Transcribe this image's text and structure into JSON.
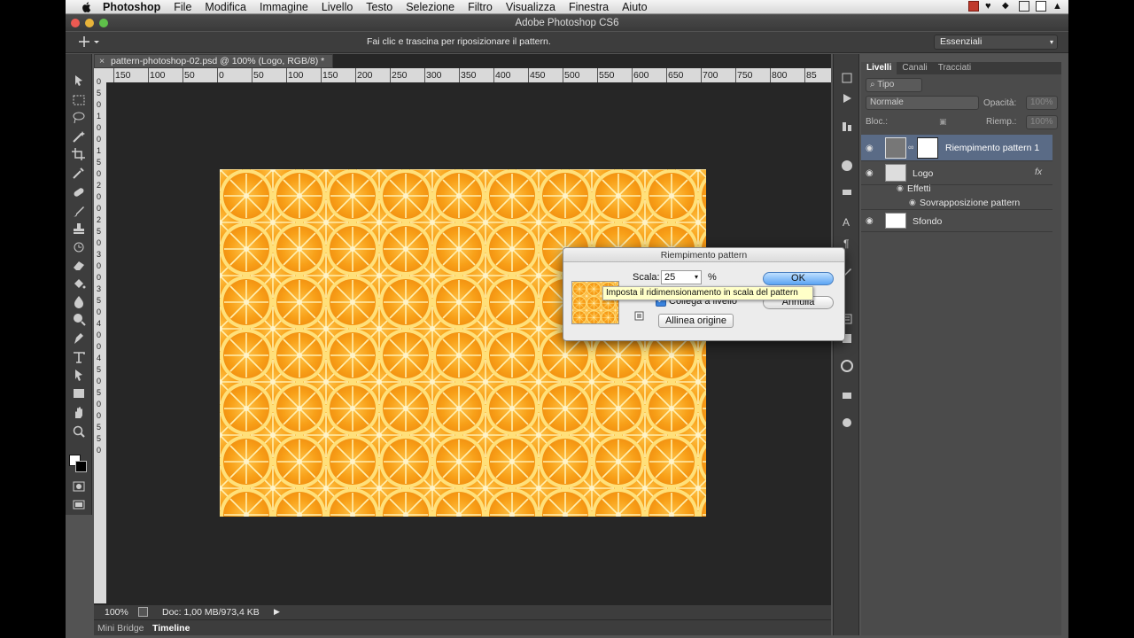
{
  "menubar": {
    "app_name": "Photoshop",
    "items": [
      "File",
      "Modifica",
      "Immagine",
      "Livello",
      "Testo",
      "Selezione",
      "Filtro",
      "Visualizza",
      "Finestra",
      "Aiuto"
    ]
  },
  "window": {
    "title": "Adobe Photoshop CS6"
  },
  "options_bar": {
    "hint": "Fai clic e trascina per riposizionare il pattern.",
    "workspace": "Essenziali"
  },
  "document": {
    "tab_title": "pattern-photoshop-02.psd @ 100% (Logo, RGB/8) *",
    "ruler_top_labels": [
      "150",
      "100",
      "50",
      "0",
      "50",
      "100",
      "150",
      "200",
      "250",
      "300",
      "350",
      "400",
      "450",
      "500",
      "550",
      "600",
      "650",
      "700",
      "750",
      "800",
      "85"
    ],
    "ruler_left_labels": [
      "0",
      "5",
      "0",
      "1",
      "0",
      "0",
      "1",
      "5",
      "0",
      "2",
      "0",
      "0",
      "2",
      "5",
      "0",
      "3",
      "0",
      "0",
      "3",
      "5",
      "0",
      "4",
      "0",
      "0",
      "4",
      "5",
      "0",
      "5",
      "0",
      "0",
      "5",
      "5",
      "0"
    ]
  },
  "status": {
    "zoom": "100%",
    "doc_info": "Doc: 1,00 MB/973,4 KB"
  },
  "bottom_tabs": [
    "Mini Bridge",
    "Timeline"
  ],
  "layers_panel": {
    "tabs": [
      "Livelli",
      "Canali",
      "Tracciati"
    ],
    "filter_label": "Tipo",
    "blend_mode": "Normale",
    "opacity_label": "Opacità:",
    "opacity_value": "100%",
    "lock_label": "Bloc.:",
    "fill_label": "Riemp.:",
    "fill_value": "100%",
    "layers": [
      {
        "name": "Riempimento pattern 1"
      },
      {
        "name": "Logo",
        "fx": "fx",
        "effects_label": "Effetti",
        "effect": "Sovrapposizione pattern"
      },
      {
        "name": "Sfondo"
      }
    ]
  },
  "dialog": {
    "title": "Riempimento pattern",
    "scale_label": "Scala:",
    "scale_value": "25",
    "percent": "%",
    "ok_label": "OK",
    "cancel_label": "Annulla",
    "link_label": "Collega a livello",
    "origin_label": "Allinea origine",
    "tooltip": "Imposta il ridimensionamento in scala del pattern"
  },
  "colors": {
    "orange": "#f7a21b",
    "orange_light": "#ffd25a",
    "accent_blue": "#5ba4f3",
    "panel": "#4b4b4b",
    "canvas_bg": "#262626"
  }
}
